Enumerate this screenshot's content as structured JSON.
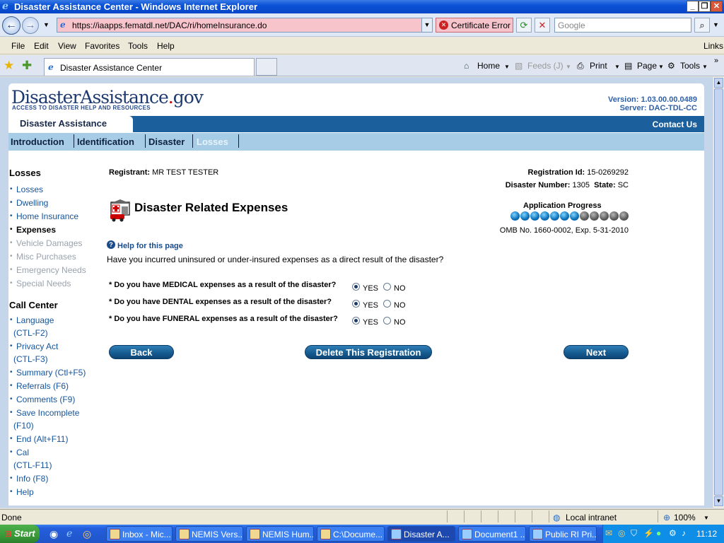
{
  "window": {
    "title": "Disaster Assistance Center - Windows Internet Explorer"
  },
  "address": {
    "url": "https://iaapps.fematdl.net/DAC/ri/homeInsurance.do",
    "cert_error": "Certificate Error",
    "search_placeholder": "Google"
  },
  "menu": [
    "File",
    "Edit",
    "View",
    "Favorites",
    "Tools",
    "Help"
  ],
  "menu_links": "Links",
  "tab": {
    "label": "Disaster Assistance Center"
  },
  "commands": {
    "home": "Home",
    "feeds": "Feeds (J)",
    "print": "Print",
    "page": "Page",
    "tools": "Tools"
  },
  "site": {
    "logo_main": "DisasterAssistance",
    "logo_dot": ".",
    "logo_gov": "gov",
    "tagline": "ACCESS TO DISASTER HELP AND RESOURCES",
    "version": "Version: 1.03.00.00.0489",
    "server": "Server: DAC-TDL-CC",
    "app_tab": "Disaster Assistance",
    "contact": "Contact Us"
  },
  "nav": [
    "Introduction",
    "Identification",
    "Disaster",
    "Losses"
  ],
  "sidebar": {
    "losses_title": "Losses",
    "losses_items": [
      {
        "label": "Losses",
        "state": "link"
      },
      {
        "label": "Dwelling",
        "state": "link"
      },
      {
        "label": "Home Insurance",
        "state": "link"
      },
      {
        "label": "Expenses",
        "state": "current"
      },
      {
        "label": "Vehicle Damages",
        "state": "disabled"
      },
      {
        "label": "Misc Purchases",
        "state": "disabled"
      },
      {
        "label": "Emergency Needs",
        "state": "disabled"
      },
      {
        "label": "Special Needs",
        "state": "disabled"
      }
    ],
    "call_title": "Call Center",
    "call_items": [
      {
        "label": "Language",
        "cont": "(CTL-F2)"
      },
      {
        "label": "Privacy Act",
        "cont": "(CTL-F3)"
      },
      {
        "label": "Summary (Ctl+F5)"
      },
      {
        "label": "Referrals (F6)"
      },
      {
        "label": "Comments (F9)"
      },
      {
        "label": "Save Incomplete",
        "cont": "(F10)"
      },
      {
        "label": "End (Alt+F11)"
      },
      {
        "label": "Cal",
        "cont": "(CTL-F11)"
      },
      {
        "label": "Info (F8)"
      },
      {
        "label": "Help"
      }
    ]
  },
  "main": {
    "registrant_label": "Registrant:",
    "registrant_value": "MR TEST TESTER",
    "reg_id_label": "Registration Id:",
    "reg_id_value": "15-0269292",
    "disaster_label": "Disaster Number:",
    "disaster_value": "1305",
    "state_label": "State:",
    "state_value": "SC",
    "title": "Disaster Related Expenses",
    "progress_label": "Application Progress",
    "progress": {
      "total": 12,
      "completed": 7
    },
    "omb": "OMB No. 1660-0002, Exp. 5-31-2010",
    "help_link": "Help for this page",
    "intro": "Have you incurred uninsured or under-insured expenses as a direct result of the disaster?",
    "questions": [
      {
        "text": "* Do you have MEDICAL expenses as a result of the disaster?",
        "yes": "YES",
        "no": "NO",
        "selected": "yes"
      },
      {
        "text": "* Do you have DENTAL expenses as a result of the disaster?",
        "yes": "YES",
        "no": "NO",
        "selected": "yes"
      },
      {
        "text": "* Do you have FUNERAL expenses as a result of the disaster?",
        "yes": "YES",
        "no": "NO",
        "selected": "yes"
      }
    ],
    "buttons": {
      "back": "Back",
      "delete": "Delete This Registration",
      "next": "Next"
    }
  },
  "status": {
    "text": "Done",
    "zone": "Local intranet",
    "zoom": "100%"
  },
  "taskbar": {
    "start": "Start",
    "tasks": [
      "Inbox - Mic...",
      "NEMIS Vers...",
      "NEMIS Hum...",
      "C:\\Docume...",
      "Disaster A...",
      "Document1 ...",
      "Public RI Pri..."
    ],
    "clock": "11:12"
  }
}
